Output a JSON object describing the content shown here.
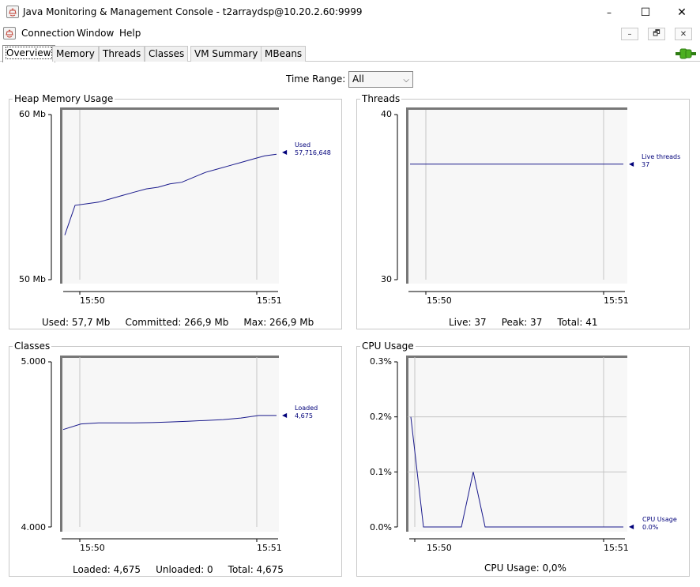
{
  "window": {
    "title": "Java Monitoring & Management Console - t2arraydsp@10.20.2.60:9999",
    "minimize_glyph": "–",
    "maximize_glyph": "☐",
    "close_glyph": "✕"
  },
  "menu": {
    "items": [
      {
        "label": "Connection"
      },
      {
        "label": "Window"
      },
      {
        "label": "Help"
      }
    ],
    "mdi_buttons": [
      "–",
      "🗗",
      "✕"
    ]
  },
  "tabs": [
    {
      "label": "Overview",
      "active": true
    },
    {
      "label": "Memory"
    },
    {
      "label": "Threads"
    },
    {
      "label": "Classes"
    },
    {
      "label": "VM Summary"
    },
    {
      "label": "MBeans"
    }
  ],
  "time_range": {
    "label": "Time Range:",
    "selected": "All"
  },
  "panels": {
    "heap": {
      "title": "Heap Memory Usage",
      "y_top": "60 Mb",
      "y_bottom": "50 Mb",
      "x_ticks": [
        "15:50",
        "15:51"
      ],
      "legend_name": "Used",
      "legend_value": "57,716,648",
      "stats": "Used: 57,7 Mb     Committed: 266,9 Mb     Max: 266,9 Mb"
    },
    "threads": {
      "title": "Threads",
      "y_top": "40",
      "y_bottom": "30",
      "x_ticks": [
        "15:50",
        "15:51"
      ],
      "legend_name": "Live threads",
      "legend_value": "37",
      "stats": "Live: 37     Peak: 37     Total: 41"
    },
    "classes": {
      "title": "Classes",
      "y_top": "5.000",
      "y_bottom": "4.000",
      "x_ticks": [
        "15:50",
        "15:51"
      ],
      "legend_name": "Loaded",
      "legend_value": "4,675",
      "stats": "Loaded: 4,675     Unloaded: 0     Total: 4,675"
    },
    "cpu": {
      "title": "CPU Usage",
      "y_ticks": [
        "0.3%",
        "0.2%",
        "0.1%",
        "0.0%"
      ],
      "x_ticks": [
        "15:50",
        "15:51"
      ],
      "legend_name": "CPU Usage",
      "legend_value": "0.0%",
      "stats": "CPU Usage: 0,0%"
    }
  },
  "chart_data": [
    {
      "type": "line",
      "title": "Heap Memory Usage",
      "ylim": [
        50,
        60
      ],
      "ylabel_unit": "Mb",
      "series": [
        {
          "name": "Used",
          "color": "#1a1a8c",
          "values": [
            52.7,
            54.5,
            54.6,
            54.7,
            54.9,
            55.1,
            55.3,
            55.5,
            55.6,
            55.8,
            55.9,
            56.2,
            56.5,
            56.7,
            56.9,
            57.1,
            57.3,
            57.5,
            57.6
          ]
        }
      ]
    },
    {
      "type": "line",
      "title": "Threads",
      "ylim": [
        30,
        40
      ],
      "series": [
        {
          "name": "Live threads",
          "color": "#1a1a8c",
          "values": [
            37,
            37
          ]
        }
      ]
    },
    {
      "type": "line",
      "title": "Classes",
      "ylim": [
        4000,
        5000
      ],
      "series": [
        {
          "name": "Loaded",
          "color": "#1a1a8c",
          "values": [
            4590,
            4624,
            4630,
            4630,
            4630,
            4632,
            4636,
            4640,
            4645,
            4650,
            4660,
            4675,
            4675
          ]
        }
      ]
    },
    {
      "type": "line",
      "title": "CPU Usage",
      "ylim": [
        0,
        0.3
      ],
      "ylabel_unit": "%",
      "grid": true,
      "series": [
        {
          "name": "CPU Usage",
          "color": "#1a1a8c",
          "values": [
            0.2,
            0.0,
            0.0,
            0.0,
            0.0,
            0.1,
            0.0,
            0.0,
            0.0,
            0.0,
            0.0,
            0.0
          ]
        }
      ]
    }
  ],
  "colors": {
    "series": "#1a1a8c",
    "plot_bg": "#f7f7f7",
    "frame": "#777777",
    "connection_indicator": "#4caf20"
  }
}
